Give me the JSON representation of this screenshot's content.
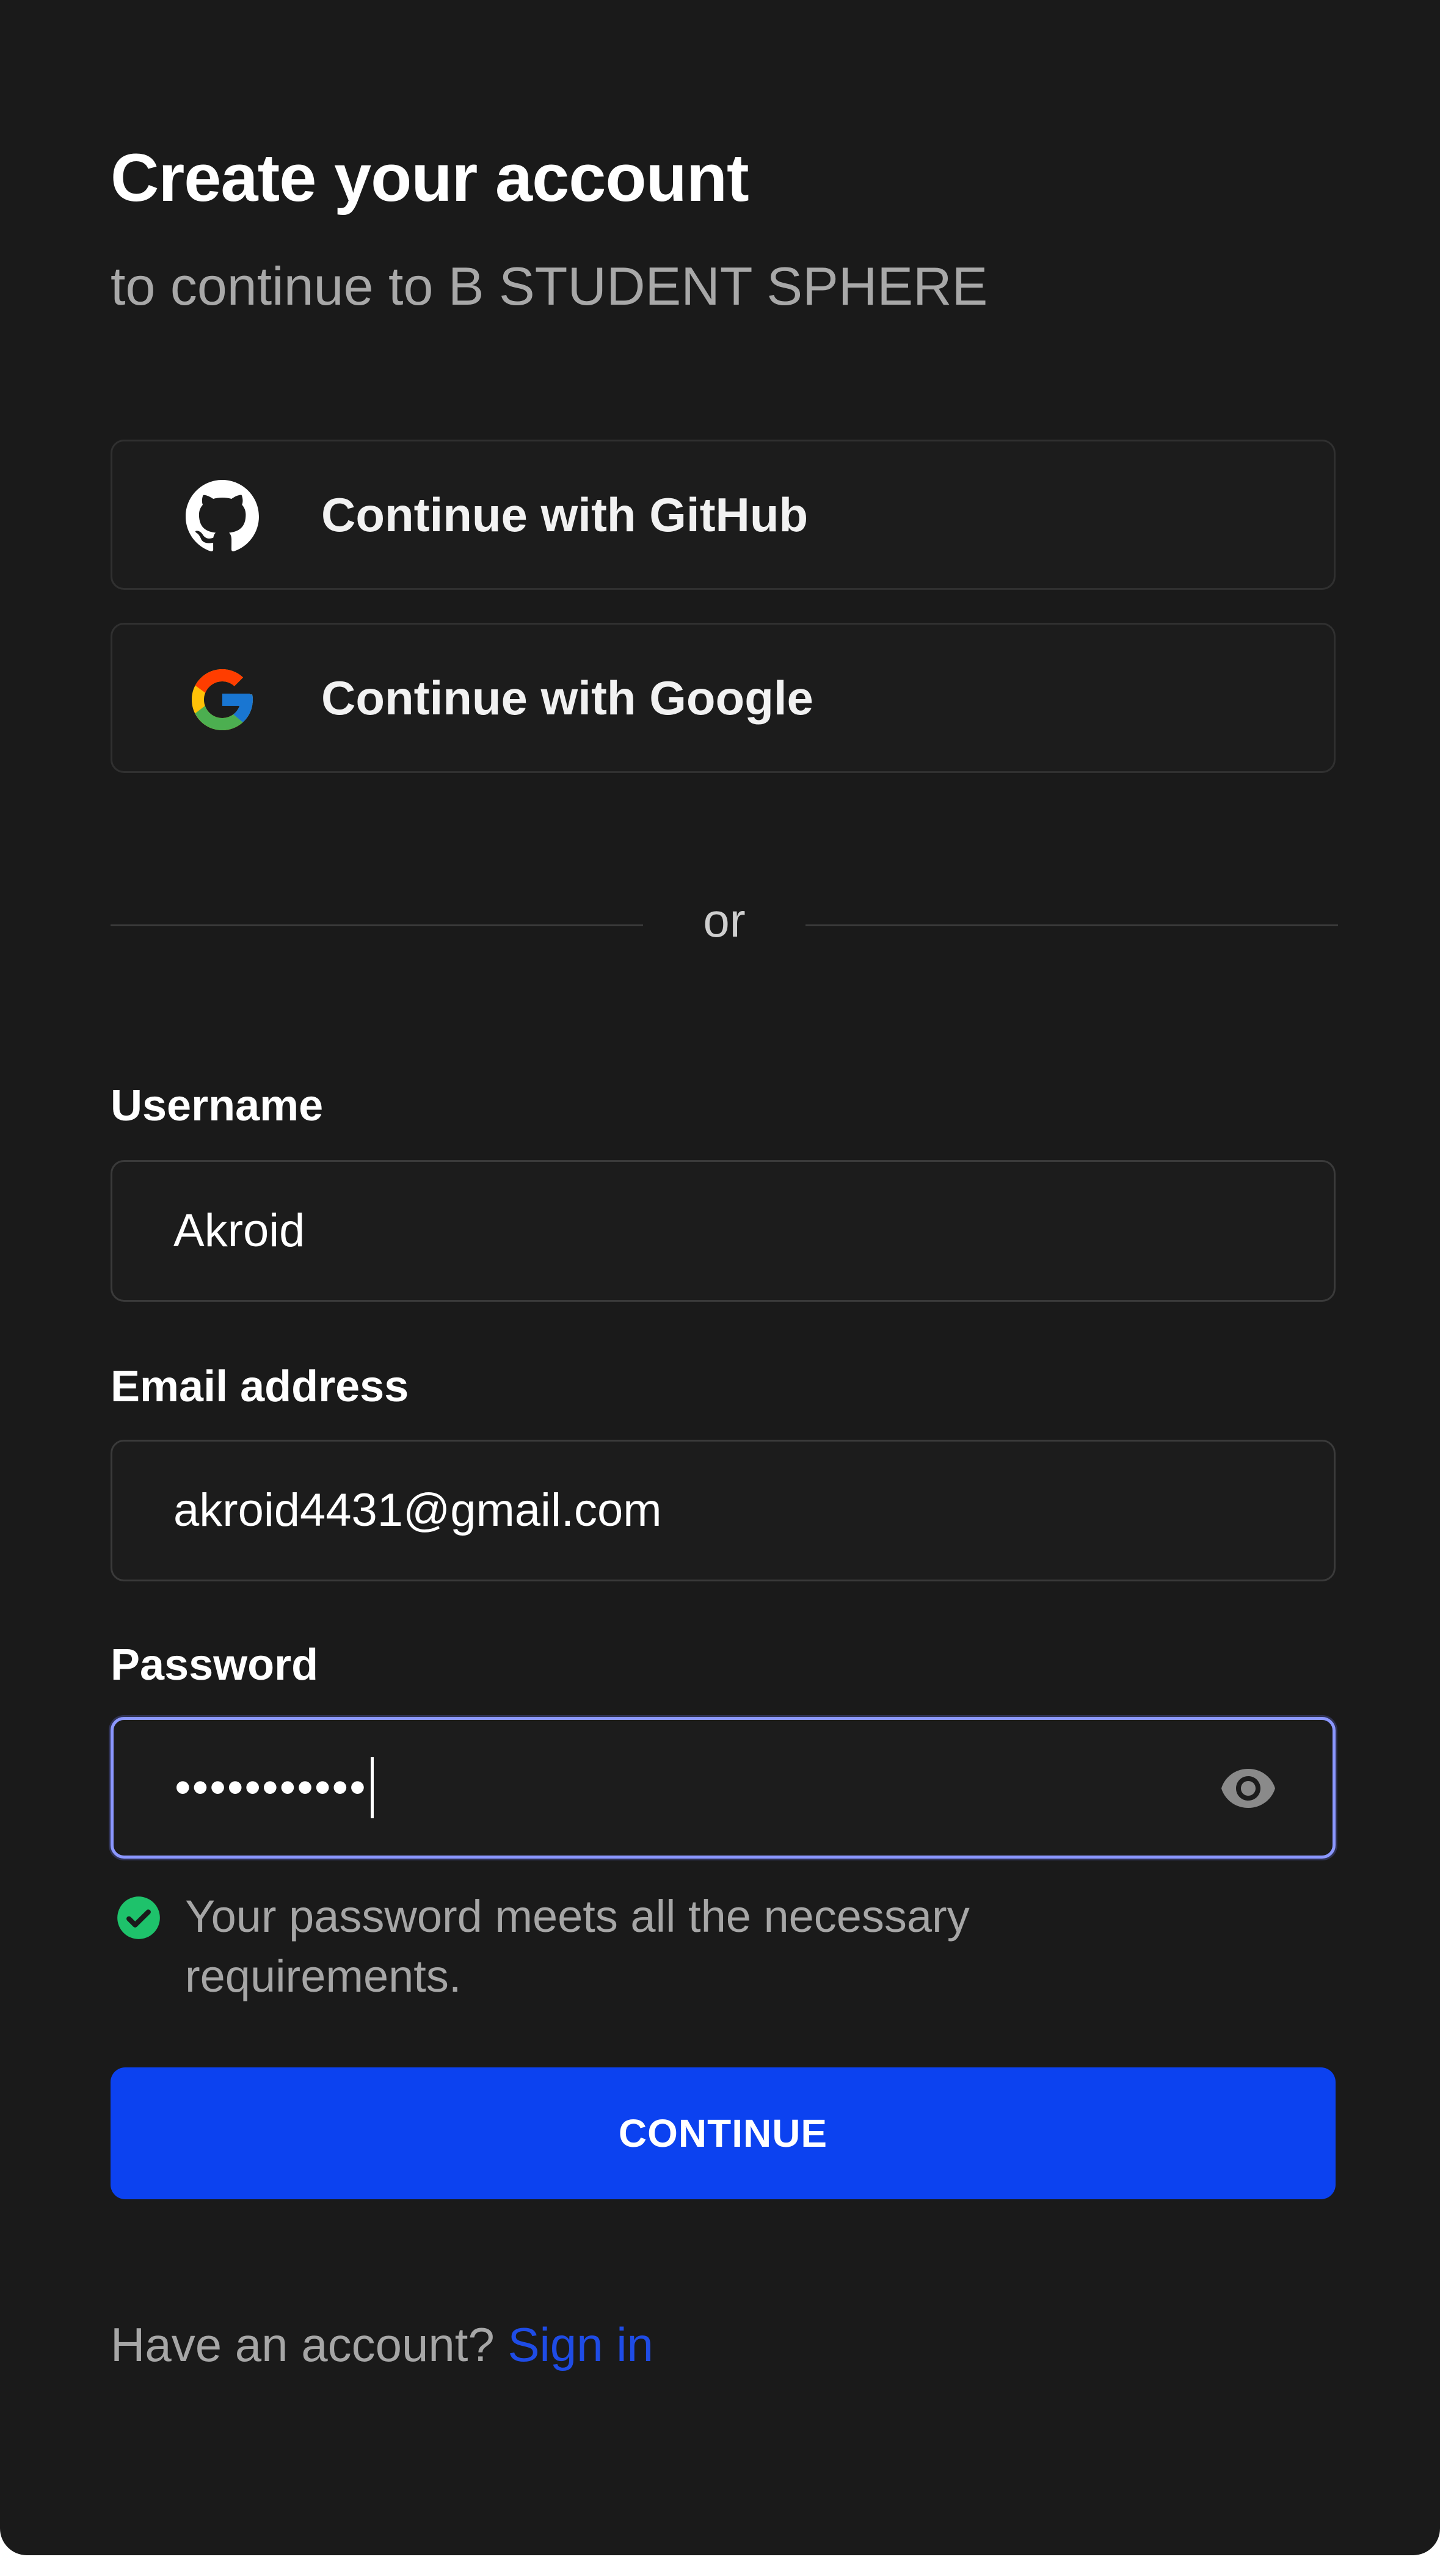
{
  "header": {
    "title": "Create your account",
    "subtitle": "to continue to B STUDENT SPHERE"
  },
  "social": {
    "github": {
      "label": "Continue with GitHub",
      "icon": "github-icon"
    },
    "google": {
      "label": "Continue with Google",
      "icon": "google-icon"
    }
  },
  "divider": {
    "text": "or"
  },
  "form": {
    "username": {
      "label": "Username",
      "value": "Akroid"
    },
    "email": {
      "label": "Email address",
      "value": "akroid4431@gmail.com"
    },
    "password": {
      "label": "Password",
      "masked_value": "•••••••••••",
      "toggle_icon": "eye-icon",
      "focused": true
    },
    "password_status": {
      "icon": "check-circle-icon",
      "text": "Your password meets all the necessary requirements.",
      "color": "#1ec26b"
    }
  },
  "actions": {
    "continue_label": "CONTINUE"
  },
  "footer": {
    "prompt": "Have an account?",
    "sign_in_label": "Sign in"
  },
  "colors": {
    "background": "#1a1a1a",
    "primary": "#0c42f0",
    "link": "#1f4ce6",
    "focus_ring": "#8b97ff"
  }
}
